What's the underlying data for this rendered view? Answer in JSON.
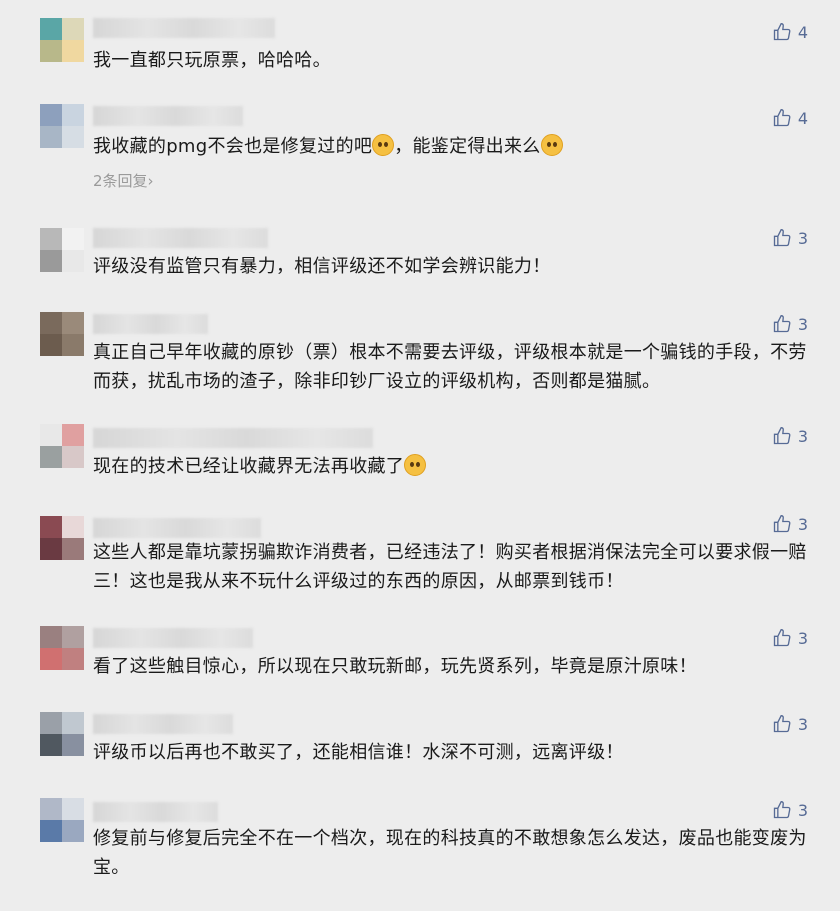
{
  "comments": [
    {
      "text": "我一直都只玩原票，哈哈哈。",
      "likes": "4",
      "avatar_colors": [
        "#5aa6a6",
        "#ddd8b8",
        "#b8b88a",
        "#f0d8a0"
      ]
    },
    {
      "text_parts": [
        "我收藏的pmg不会也是修复过的吧",
        "，能鉴定得出来么"
      ],
      "likes": "4",
      "replies": "2条回复",
      "avatar_colors": [
        "#8da0bd",
        "#c9d4e0",
        "#a8b6c6",
        "#d6dde4"
      ]
    },
    {
      "text": "评级没有监管只有暴力，相信评级还不如学会辨识能力！",
      "likes": "3",
      "avatar_colors": [
        "#b8b8b8",
        "#f2f2f2",
        "#9a9a9a",
        "#e8e8e8"
      ]
    },
    {
      "text": "真正自己早年收藏的原钞（票）根本不需要去评级，评级根本就是一个骗钱的手段，不劳而获，扰乱市场的渣子，除非印钞厂设立的评级机构，否则都是猫腻。",
      "likes": "3",
      "avatar_colors": [
        "#7a6a5c",
        "#9a8a7a",
        "#6c5c4e",
        "#8a7a6a"
      ]
    },
    {
      "text_parts": [
        "现在的技术已经让收藏界无法再收藏了"
      ],
      "likes": "3",
      "avatar_colors": [
        "#e8e8e8",
        "#e0a0a0",
        "#9aa0a0",
        "#d8c8c8"
      ]
    },
    {
      "text": "这些人都是靠坑蒙拐骗欺诈消费者，已经违法了！购买者根据消保法完全可以要求假一赔三！这也是我从来不玩什么评级过的东西的原因，从邮票到钱币！",
      "likes": "3",
      "avatar_colors": [
        "#8a4a52",
        "#e8d8d8",
        "#6a3a42",
        "#9a7a7a"
      ]
    },
    {
      "text": "看了这些触目惊心，所以现在只敢玩新邮，玩先贤系列，毕竟是原汁原味！",
      "likes": "3",
      "avatar_colors": [
        "#9a8080",
        "#b0a0a0",
        "#d07070",
        "#c08080"
      ]
    },
    {
      "text": "评级币以后再也不敢买了，还能相信谁！水深不可测，远离评级！",
      "likes": "3",
      "avatar_colors": [
        "#9aa0a8",
        "#c0c8d0",
        "#505860",
        "#8890a0"
      ]
    },
    {
      "text": "修复前与修复后完全不在一个档次，现在的科技真的不敢想象怎么发达，废品也能变废为宝。",
      "likes": "3",
      "avatar_colors": [
        "#b0b8c8",
        "#d8dde4",
        "#5a7aa8",
        "#9aa8c0"
      ]
    }
  ]
}
